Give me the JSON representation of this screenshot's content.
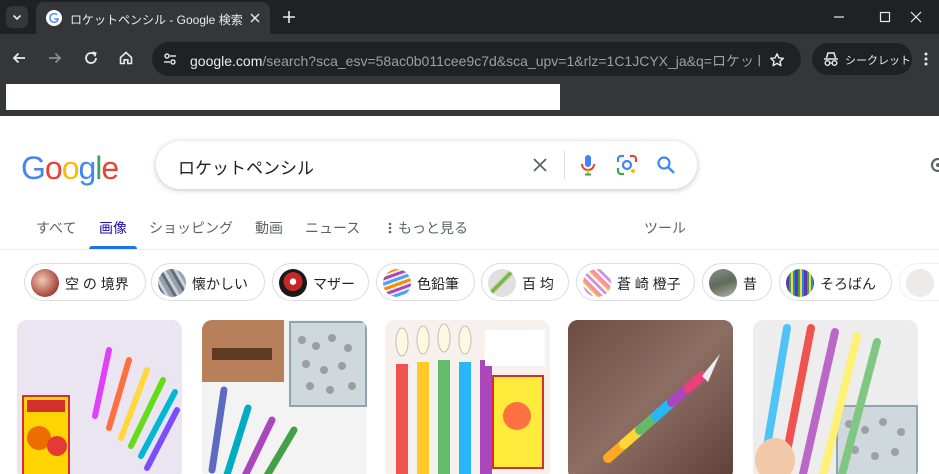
{
  "browser": {
    "tab_title": "ロケットペンシル - Google 検索",
    "url_host": "google.com",
    "url_rest": "/search?sca_esv=58ac0b011cee9c7d&sca_upv=1&rlz=1C1JCYX_ja&q=ロケットペ...",
    "incognito_label": "シークレット"
  },
  "search": {
    "query": "ロケットペンシル"
  },
  "nav_tabs": [
    {
      "label": "すべて"
    },
    {
      "label": "画像"
    },
    {
      "label": "ショッピング"
    },
    {
      "label": "動画"
    },
    {
      "label": "ニュース"
    },
    {
      "label": "もっと見る"
    },
    {
      "label": "ツール"
    }
  ],
  "chips": [
    {
      "label": "空 の 境界"
    },
    {
      "label": "懐かしい"
    },
    {
      "label": "マザー"
    },
    {
      "label": "色鉛筆"
    },
    {
      "label": "百 均"
    },
    {
      "label": "蒼 崎 橙子"
    },
    {
      "label": "昔"
    },
    {
      "label": "そろばん"
    }
  ],
  "colors": {
    "active_tab": "#1a0dab",
    "accent": "#1a73e8",
    "g_blue": "#4285f4",
    "g_red": "#ea4335",
    "g_yellow": "#fbbc05",
    "g_green": "#34a853"
  }
}
